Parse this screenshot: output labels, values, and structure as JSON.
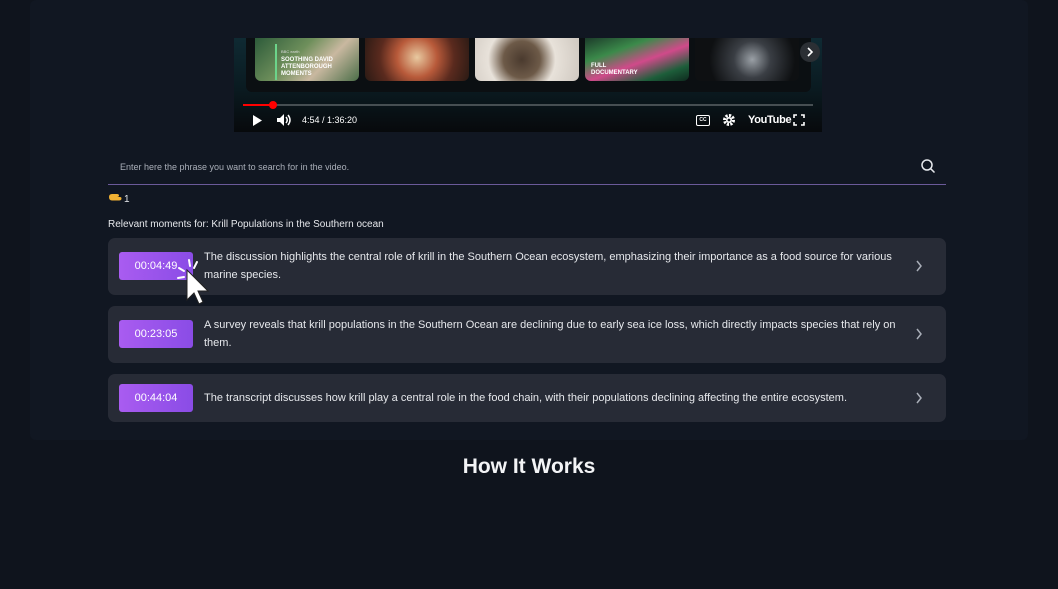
{
  "player": {
    "thumbnails": [
      {
        "brand": "BBC earth",
        "label": "Soothing David Attenborough Moments"
      },
      {
        "label": ""
      },
      {
        "label": ""
      },
      {
        "label": "Full Documentary"
      },
      {
        "label": ""
      }
    ],
    "progress_fraction": 0.052,
    "time_display": "4:54 / 1:36:20",
    "logo": "YouTube",
    "icons": [
      "play-icon",
      "volume-icon",
      "chevron-right-icon",
      "closed-captions-icon",
      "gear-icon",
      "fullscreen-icon"
    ]
  },
  "search": {
    "placeholder": "Enter here the phrase you want to search for in the video.",
    "value": ""
  },
  "results_count": "1",
  "relevant_label": "Relevant moments for: Krill Populations in the Southern ocean",
  "results": [
    {
      "timestamp": "00:04:49",
      "text": "The discussion highlights the central role of krill in the Southern Ocean ecosystem, emphasizing their importance as a food source for various marine species."
    },
    {
      "timestamp": "00:23:05",
      "text": "A survey reveals that krill populations in the Southern Ocean are declining due to early sea ice loss, which directly impacts species that rely on them."
    },
    {
      "timestamp": "00:44:04",
      "text": "The transcript discusses how krill play a central role in the food chain, with their populations declining affecting the entire ecosystem."
    }
  ],
  "section_title": "How It Works",
  "colors": {
    "accent": "#9a55ec",
    "card": "#272b36",
    "background": "#0f141d",
    "progress": "#ff0000"
  }
}
